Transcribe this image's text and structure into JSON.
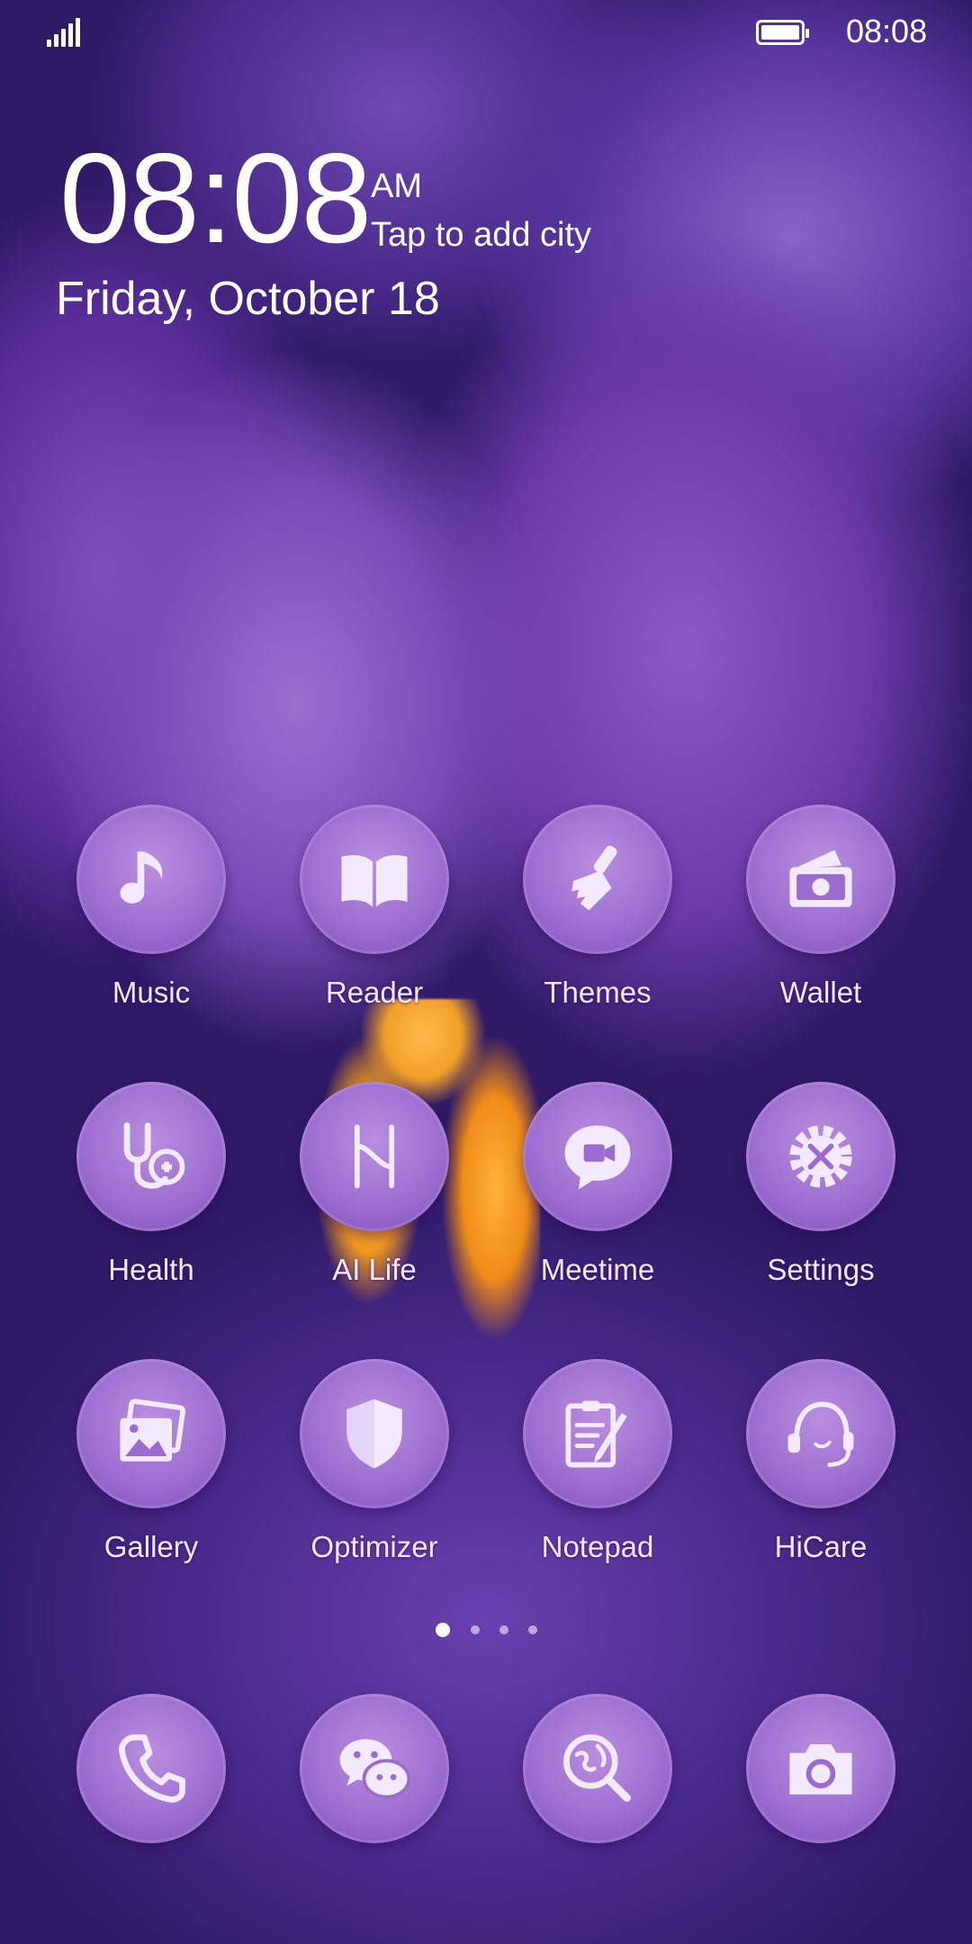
{
  "status_bar": {
    "time": "08:08"
  },
  "clock": {
    "time": "08:08",
    "ampm": "AM",
    "city": "Tap to add city",
    "date": "Friday, October 18"
  },
  "apps": [
    {
      "label": "Music",
      "icon": "music-note-icon"
    },
    {
      "label": "Reader",
      "icon": "book-icon"
    },
    {
      "label": "Themes",
      "icon": "paintbrush-icon"
    },
    {
      "label": "Wallet",
      "icon": "wallet-icon"
    },
    {
      "label": "Health",
      "icon": "stethoscope-icon"
    },
    {
      "label": "AI Life",
      "icon": "ai-life-icon"
    },
    {
      "label": "Meetime",
      "icon": "video-chat-icon"
    },
    {
      "label": "Settings",
      "icon": "gear-icon"
    },
    {
      "label": "Gallery",
      "icon": "gallery-icon"
    },
    {
      "label": "Optimizer",
      "icon": "shield-icon"
    },
    {
      "label": "Notepad",
      "icon": "notepad-icon"
    },
    {
      "label": "HiCare",
      "icon": "headset-icon"
    }
  ],
  "dock": [
    {
      "icon": "phone-icon"
    },
    {
      "icon": "wechat-icon"
    },
    {
      "icon": "browser-search-icon"
    },
    {
      "icon": "camera-icon"
    }
  ],
  "page_indicator": {
    "pages": 4,
    "current": 1
  },
  "colors": {
    "icon_fill": "#9b6ccf",
    "glyph": "#f4eaff",
    "wallpaper": "#5a36a6",
    "stamen": "#f29a1e"
  }
}
